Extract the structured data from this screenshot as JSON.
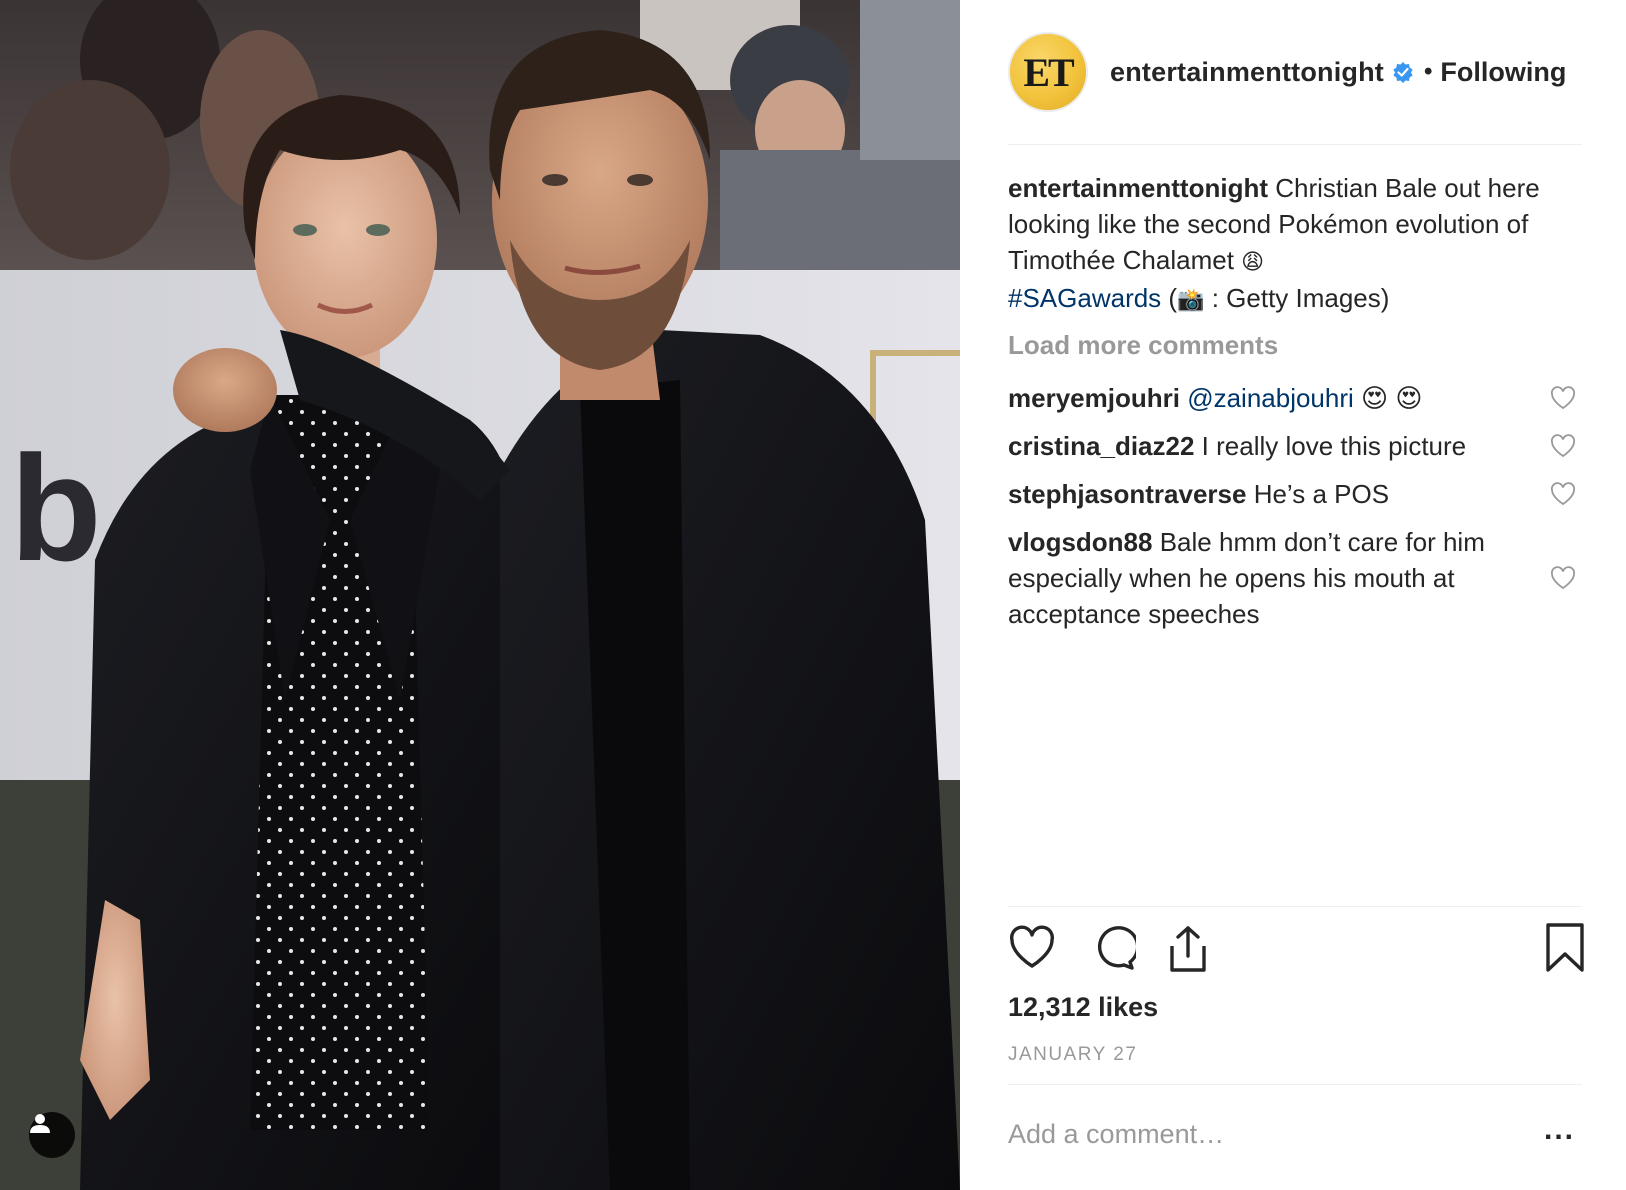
{
  "post": {
    "image_alt": "Two men in black suits posing together on a red carpet",
    "author": {
      "avatar_text": "ET",
      "username": "entertainmenttonight",
      "verified": true,
      "follow_status": "Following"
    },
    "caption": {
      "username": "entertainmenttonight",
      "text_1": "Christian Bale out here looking like the second Pokémon evolution of Timothée Chalamet",
      "emoji_1": "😩",
      "hashtag": "#SAGawards",
      "text_2_open": " (",
      "emoji_2": "📸",
      "text_2_close": " : Getty Images)"
    },
    "load_more_label": "Load more comments",
    "comments": [
      {
        "username": "meryemjouhri",
        "mention": "@zainabjouhri",
        "text": " 😍 😍"
      },
      {
        "username": "cristina_diaz22",
        "text": "I really love this picture"
      },
      {
        "username": "stephjasontraverse",
        "text": "He’s a POS"
      },
      {
        "username": "vlogsdon88",
        "text": "Bale hmm don’t care for him especially when he opens his mouth at acceptance speeches"
      }
    ],
    "likes_label": "12,312 likes",
    "date_label": "JANUARY 27",
    "comment_placeholder": "Add a comment…",
    "more_label": "..."
  },
  "colors": {
    "text": "#262626",
    "muted": "#999999",
    "link": "#003569",
    "verified": "#3897f0",
    "avatar": "#f2c33c"
  }
}
